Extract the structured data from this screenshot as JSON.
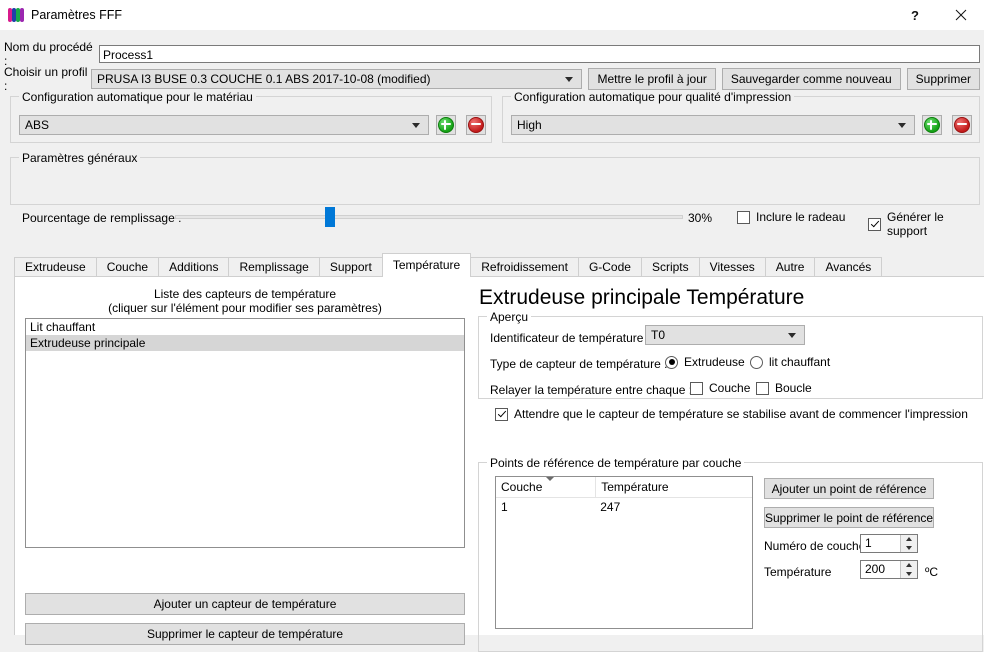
{
  "window": {
    "title": "Paramètres FFF",
    "help_label": "?",
    "close_label": "×"
  },
  "process": {
    "name_label": "Nom du procédé :",
    "name_value": "Process1",
    "profile_label": "Choisir un profil :",
    "profile_value": "PRUSA I3 BUSE 0.3 COUCHE 0.1 ABS 2017-10-08 (modified)",
    "update_profile_button": "Mettre le profil à jour",
    "save_as_new_button": "Sauvegarder comme nouveau",
    "delete_button": "Supprimer"
  },
  "material_group": {
    "legend": "Configuration automatique pour le matériau",
    "value": "ABS",
    "add_label": "+",
    "remove_label": "−"
  },
  "quality_group": {
    "legend": "Configuration automatique pour qualité d'impression",
    "value": "High",
    "add_label": "+",
    "remove_label": "−"
  },
  "general_group": {
    "legend": "Paramètres généraux",
    "infill_label": "Pourcentage de remplissage :",
    "infill_value": "30%",
    "infill_percent": 30,
    "raft_label": "Inclure le radeau",
    "raft_checked": false,
    "support_label": "Générer le support",
    "support_checked": true
  },
  "tabs": [
    {
      "label": "Extrudeuse",
      "active": false
    },
    {
      "label": "Couche",
      "active": false
    },
    {
      "label": "Additions",
      "active": false
    },
    {
      "label": "Remplissage",
      "active": false
    },
    {
      "label": "Support",
      "active": false
    },
    {
      "label": "Température",
      "active": true
    },
    {
      "label": "Refroidissement",
      "active": false
    },
    {
      "label": "G-Code",
      "active": false
    },
    {
      "label": "Scripts",
      "active": false
    },
    {
      "label": "Vitesses",
      "active": false
    },
    {
      "label": "Autre",
      "active": false
    },
    {
      "label": "Avancés",
      "active": false
    }
  ],
  "sensor_list": {
    "caption_line1": "Liste des capteurs de température",
    "caption_line2": "(cliquer sur l'élément pour modifier ses paramètres)",
    "items": [
      {
        "label": "Lit chauffant",
        "selected": false
      },
      {
        "label": "Extrudeuse principale",
        "selected": true
      }
    ],
    "add_button": "Ajouter un capteur de température",
    "remove_button": "Supprimer le capteur de température"
  },
  "detail": {
    "title": "Extrudeuse principale Température",
    "overview_group": {
      "legend": "Aperçu",
      "identifier_label": "Identificateur de température",
      "identifier_value": "T0",
      "sensor_type_label": "Type de capteur de température :",
      "radio_extruder_label": "Extrudeuse",
      "radio_extruder_checked": true,
      "radio_bed_label": "lit chauffant",
      "radio_bed_checked": false,
      "relay_label": "Relayer la température entre chaque :",
      "relay_layer_label": "Couche",
      "relay_layer_checked": false,
      "relay_loop_label": "Boucle",
      "relay_loop_checked": false,
      "wait_label": "Attendre que le capteur de température se stabilise avant de commencer l'impression",
      "wait_checked": true
    },
    "setpoints_group": {
      "legend": "Points de référence de température par couche",
      "columns": [
        "Couche",
        "Température"
      ],
      "rows": [
        [
          "1",
          "247"
        ]
      ],
      "add_button": "Ajouter un point de référence",
      "remove_button": "Supprimer le point de référence",
      "layer_number_label": "Numéro de couche",
      "layer_number_value": "1",
      "temperature_label": "Température",
      "temperature_value": "200",
      "temperature_unit": "ºC"
    }
  },
  "colors": {
    "accent": "#0078d7",
    "window_bg": "#f0f0f0",
    "panel_bg": "#ffffff",
    "selection": "#d6d6d6"
  }
}
